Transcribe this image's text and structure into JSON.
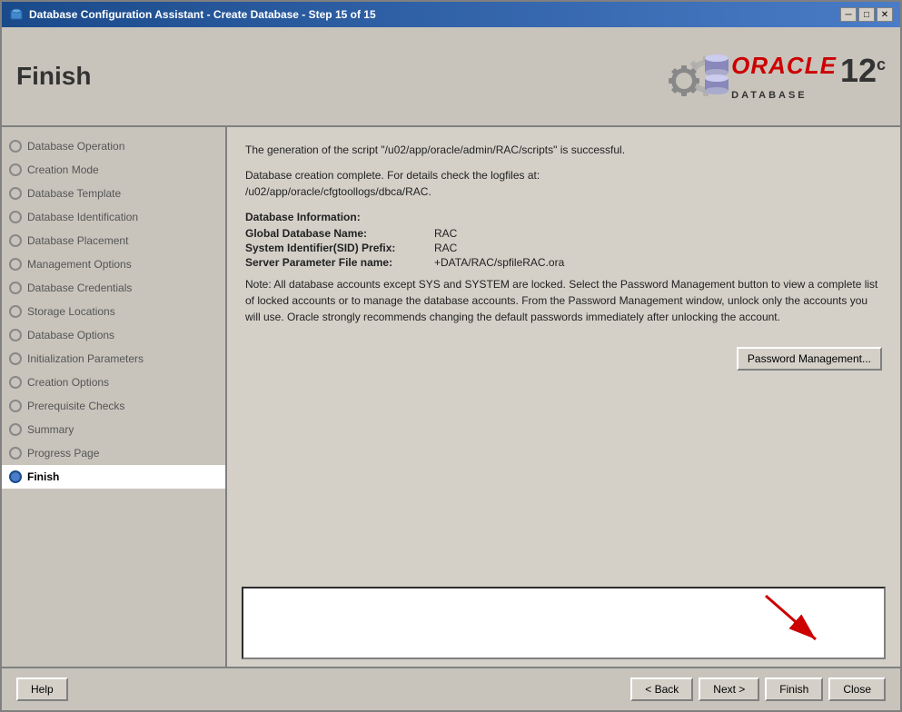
{
  "window": {
    "title": "Database Configuration Assistant - Create Database - Step 15 of 15",
    "icon": "db-icon"
  },
  "header": {
    "title": "Finish",
    "oracle_text": "ORACLE",
    "database_text": "DATABASE",
    "version": "12",
    "version_suffix": "c"
  },
  "sidebar": {
    "items": [
      {
        "id": "database-operation",
        "label": "Database Operation",
        "state": "done"
      },
      {
        "id": "creation-mode",
        "label": "Creation Mode",
        "state": "done"
      },
      {
        "id": "database-template",
        "label": "Database Template",
        "state": "done"
      },
      {
        "id": "database-identification",
        "label": "Database Identification",
        "state": "done"
      },
      {
        "id": "database-placement",
        "label": "Database Placement",
        "state": "done"
      },
      {
        "id": "management-options",
        "label": "Management Options",
        "state": "done"
      },
      {
        "id": "database-credentials",
        "label": "Database Credentials",
        "state": "done"
      },
      {
        "id": "storage-locations",
        "label": "Storage Locations",
        "state": "done"
      },
      {
        "id": "database-options",
        "label": "Database Options",
        "state": "done"
      },
      {
        "id": "initialization-parameters",
        "label": "Initialization Parameters",
        "state": "done"
      },
      {
        "id": "creation-options",
        "label": "Creation Options",
        "state": "done"
      },
      {
        "id": "prerequisite-checks",
        "label": "Prerequisite Checks",
        "state": "done"
      },
      {
        "id": "summary",
        "label": "Summary",
        "state": "done"
      },
      {
        "id": "progress-page",
        "label": "Progress Page",
        "state": "done"
      },
      {
        "id": "finish",
        "label": "Finish",
        "state": "active"
      }
    ]
  },
  "content": {
    "line1": "The generation of the script \"/u02/app/oracle/admin/RAC/scripts\" is successful.",
    "line2": "Database creation complete. For details check the logfiles at:",
    "line3": " /u02/app/oracle/cfgtoollogs/dbca/RAC.",
    "db_info_title": "Database Information:",
    "global_db_label": "Global Database Name:",
    "global_db_value": "RAC",
    "sid_label": "System Identifier(SID) Prefix:",
    "sid_value": "RAC",
    "spfile_label": "Server Parameter File name:",
    "spfile_value": "+DATA/RAC/spfileRAC.ora",
    "note": "Note:  All database accounts except SYS and SYSTEM are locked. Select the Password Management button to view a complete list of locked accounts or to manage the database accounts. From the Password Management window, unlock only the accounts you will use. Oracle strongly recommends changing the default passwords immediately after unlocking the account.",
    "password_btn_label": "Password Management..."
  },
  "footer": {
    "help_label": "Help",
    "back_label": "< Back",
    "next_label": "Next >",
    "finish_label": "Finish",
    "close_label": "Close"
  }
}
